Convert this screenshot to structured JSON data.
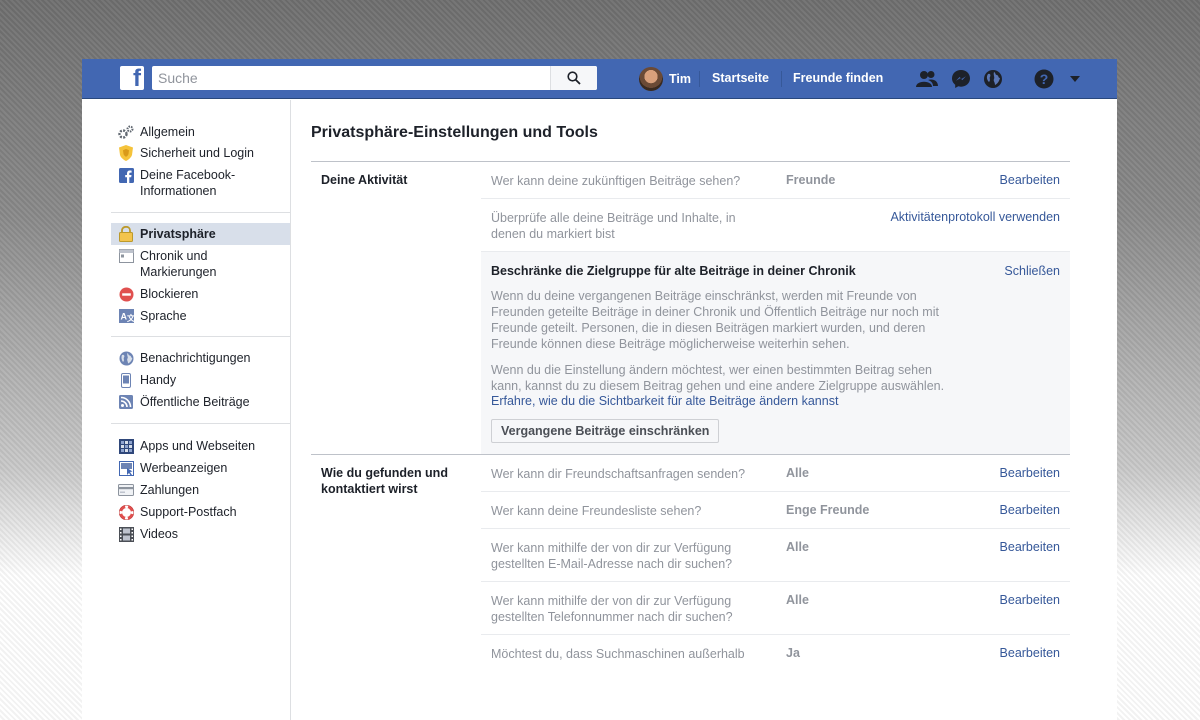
{
  "header": {
    "logo": "f",
    "search_placeholder": "Suche",
    "search_icon": "search-icon",
    "user_name": "Tim",
    "nav_home": "Startseite",
    "nav_find_friends": "Freunde finden",
    "icons": [
      "friend-requests-icon",
      "messenger-icon",
      "notifications-globe-icon",
      "help-icon",
      "chevron-down-icon"
    ],
    "brand_color": "#4267b2"
  },
  "sidebar": {
    "groups": [
      [
        {
          "label": "Allgemein",
          "icon": "gear-icon"
        },
        {
          "label": "Sicherheit und Login",
          "icon": "shield-icon"
        },
        {
          "label": "Deine Facebook-Informationen",
          "icon": "facebook-icon"
        }
      ],
      [
        {
          "label": "Privatsphäre",
          "icon": "lock-icon",
          "active": true
        },
        {
          "label": "Chronik und Markierungen",
          "icon": "timeline-icon"
        },
        {
          "label": "Blockieren",
          "icon": "block-icon"
        },
        {
          "label": "Sprache",
          "icon": "language-icon"
        }
      ],
      [
        {
          "label": "Benachrichtigungen",
          "icon": "globe-icon"
        },
        {
          "label": "Handy",
          "icon": "mobile-icon"
        },
        {
          "label": "Öffentliche Beiträge",
          "icon": "rss-icon"
        }
      ],
      [
        {
          "label": "Apps und Webseiten",
          "icon": "apps-icon"
        },
        {
          "label": "Werbeanzeigen",
          "icon": "ads-icon"
        },
        {
          "label": "Zahlungen",
          "icon": "credit-card-icon"
        },
        {
          "label": "Support-Postfach",
          "icon": "lifebuoy-icon"
        },
        {
          "label": "Videos",
          "icon": "film-icon"
        }
      ]
    ]
  },
  "main": {
    "title": "Privatsphäre-Einstellungen und Tools",
    "section1": {
      "title": "Deine Aktivität",
      "row1": {
        "question": "Wer kann deine zukünftigen Beiträge sehen?",
        "value": "Freunde",
        "action": "Bearbeiten"
      },
      "row2": {
        "question": "Überprüfe alle deine Beiträge und Inhalte, in denen du markiert bist",
        "action": "Aktivitätenprotokoll verwenden"
      },
      "expanded": {
        "title": "Beschränke die Zielgruppe für alte Beiträge in deiner Chronik",
        "close": "Schließen",
        "p1": "Wenn du deine vergangenen Beiträge einschränkst, werden mit Freunde von Freunden geteilte Beiträge in deiner Chronik und Öffentlich Beiträge nur noch mit Freunde geteilt. Personen, die in diesen Beiträgen markiert wurden, und deren Freunde können diese Beiträge möglicherweise weiterhin sehen.",
        "p2": "Wenn du die Einstellung ändern möchtest, wer einen bestimmten Beitrag sehen kann, kannst du zu diesem Beitrag gehen und eine andere Zielgruppe auswählen.",
        "link": "Erfahre, wie du die Sichtbarkeit für alte Beiträge ändern kannst",
        "button": "Vergangene Beiträge einschränken"
      }
    },
    "section2": {
      "title": "Wie du gefunden und kontaktiert wirst",
      "rows": [
        {
          "question": "Wer kann dir Freundschaftsanfragen senden?",
          "value": "Alle",
          "action": "Bearbeiten"
        },
        {
          "question": "Wer kann deine Freundesliste sehen?",
          "value": "Enge Freunde",
          "action": "Bearbeiten"
        },
        {
          "question": "Wer kann mithilfe der von dir zur Verfügung gestellten E-Mail-Adresse nach dir suchen?",
          "value": "Alle",
          "action": "Bearbeiten"
        },
        {
          "question": "Wer kann mithilfe der von dir zur Verfügung gestellten Telefonnummer nach dir suchen?",
          "value": "Alle",
          "action": "Bearbeiten"
        },
        {
          "question": "Möchtest du, dass Suchmaschinen außerhalb",
          "value": "Ja",
          "action": "Bearbeiten"
        }
      ]
    }
  }
}
